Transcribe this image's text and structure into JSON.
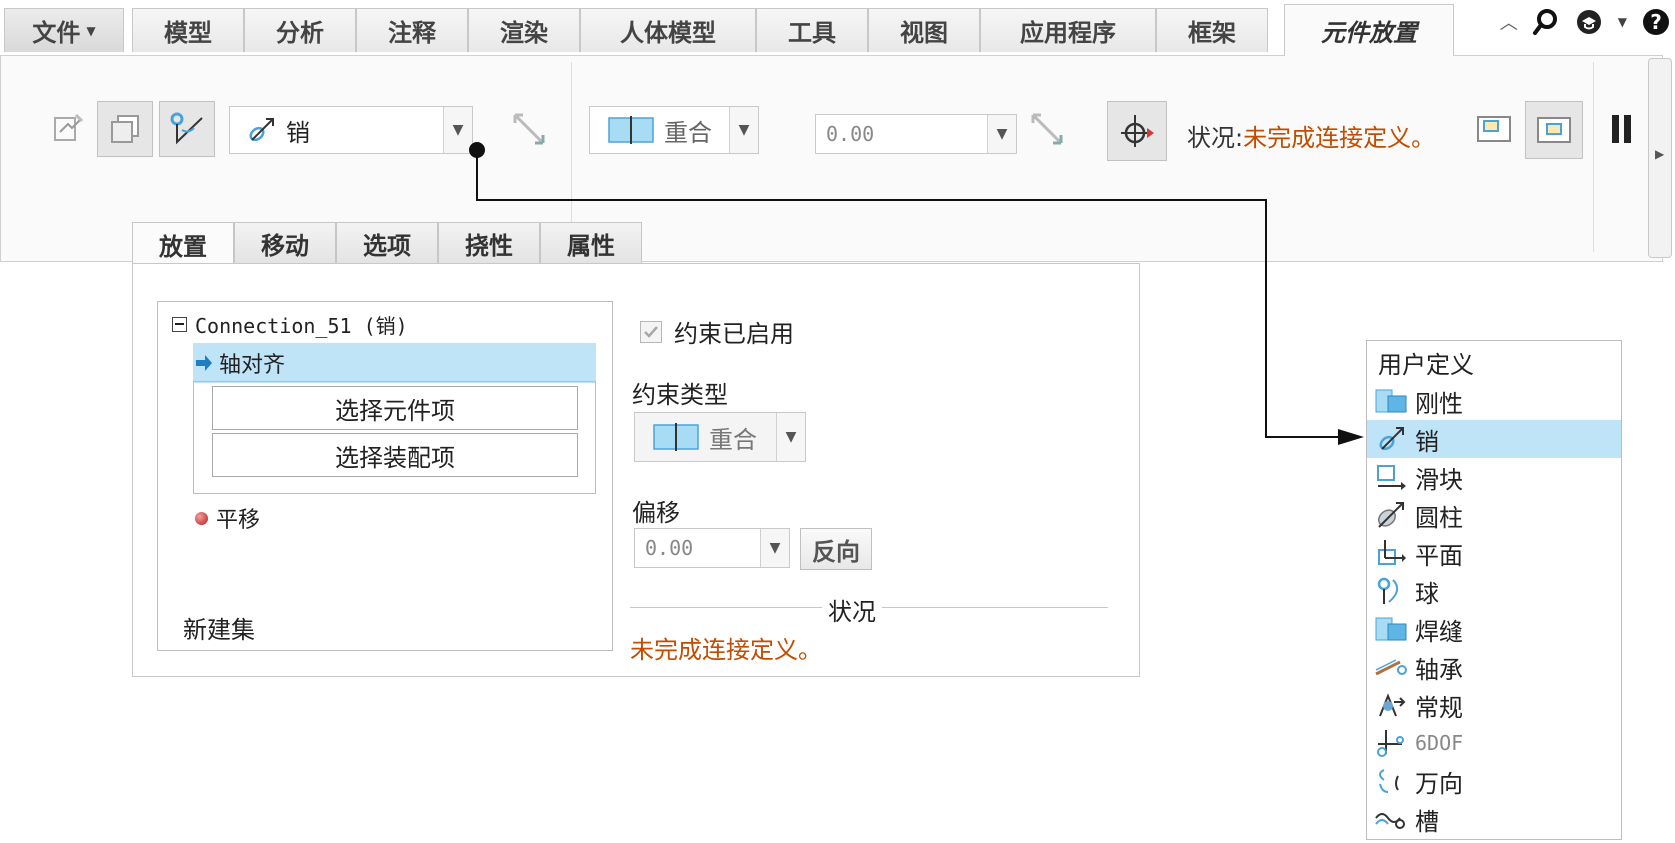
{
  "ribbon_tabs": [
    {
      "label": "文件",
      "has_dropdown": true
    },
    {
      "label": "模型"
    },
    {
      "label": "分析"
    },
    {
      "label": "注释"
    },
    {
      "label": "渲染"
    },
    {
      "label": "人体模型"
    },
    {
      "label": "工具"
    },
    {
      "label": "视图"
    },
    {
      "label": "应用程序"
    },
    {
      "label": "框架"
    },
    {
      "label": "元件放置",
      "active": true
    }
  ],
  "toolbar": {
    "connection_type_value": "销",
    "constraint_type_value": "重合",
    "offset_value": "0.00",
    "status_label": "状况:",
    "status_value": "未完成连接定义。"
  },
  "dashboard_tabs": [
    {
      "label": "放置",
      "active": true
    },
    {
      "label": "移动"
    },
    {
      "label": "选项"
    },
    {
      "label": "挠性"
    },
    {
      "label": "属性"
    }
  ],
  "placement": {
    "connection_node": "Connection_51 (销)",
    "constraint_item": "轴对齐",
    "collectors": [
      "选择元件项",
      "选择装配项"
    ],
    "translation_item": "平移",
    "new_set_label": "新建集",
    "constraint_enabled_label": "约束已启用",
    "constraint_type_label": "约束类型",
    "constraint_type_value": "重合",
    "offset_label": "偏移",
    "offset_value": "0.00",
    "flip_button": "反向",
    "status_caption": "状况",
    "status_value": "未完成连接定义。"
  },
  "connection_types": {
    "header": "用户定义",
    "items": [
      {
        "label": "刚性",
        "icon": "rigid-icon"
      },
      {
        "label": "销",
        "icon": "pin-icon",
        "selected": true
      },
      {
        "label": "滑块",
        "icon": "slider-icon"
      },
      {
        "label": "圆柱",
        "icon": "cylinder-icon"
      },
      {
        "label": "平面",
        "icon": "planar-icon"
      },
      {
        "label": "球",
        "icon": "ball-icon"
      },
      {
        "label": "焊缝",
        "icon": "weld-icon"
      },
      {
        "label": "轴承",
        "icon": "bearing-icon"
      },
      {
        "label": "常规",
        "icon": "general-icon"
      },
      {
        "label": "6DOF",
        "icon": "6dof-icon"
      },
      {
        "label": "万向",
        "icon": "gimbal-icon"
      },
      {
        "label": "槽",
        "icon": "slot-icon"
      }
    ]
  },
  "colors": {
    "accent_selection": "#bfe3f7",
    "status_text": "#c24c00",
    "icon_blue": "#4aa3d8"
  }
}
